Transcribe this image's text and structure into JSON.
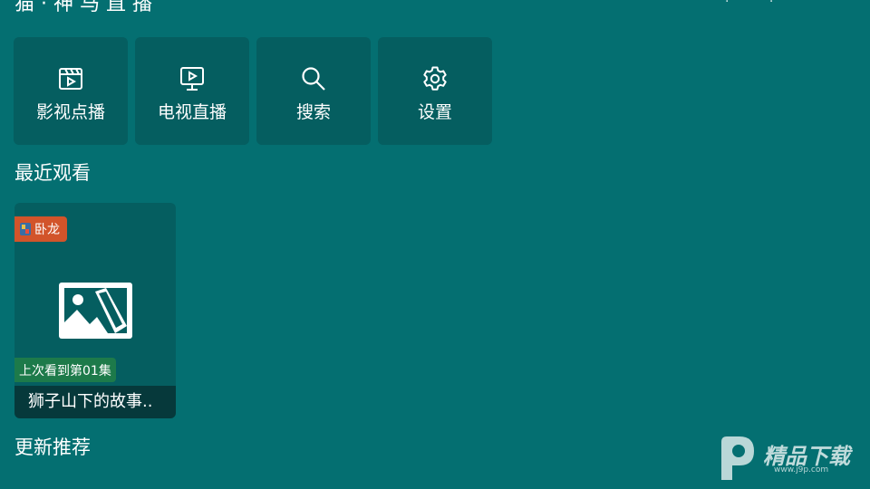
{
  "header": {
    "title": "猫 · 神 马 直 播",
    "right_dots": "· ·"
  },
  "tiles": [
    {
      "label": "影视点播",
      "icon": "film-icon"
    },
    {
      "label": "电视直播",
      "icon": "tv-play-icon"
    },
    {
      "label": "搜索",
      "icon": "search-icon"
    },
    {
      "label": "设置",
      "icon": "gear-icon"
    }
  ],
  "recent": {
    "section_title": "最近观看",
    "items": [
      {
        "source": "卧龙",
        "progress": "上次看到第01集",
        "title": "狮子山下的故事.."
      }
    ]
  },
  "updates": {
    "section_title": "更新推荐"
  },
  "watermark": {
    "text": "精品下载",
    "url": "www.j9p.com"
  },
  "colors": {
    "background": "#046f71",
    "tile": "#055e60",
    "source_badge": "#d2542a",
    "progress_badge": "#1d7a4a",
    "card_title_bar": "#06393b"
  }
}
